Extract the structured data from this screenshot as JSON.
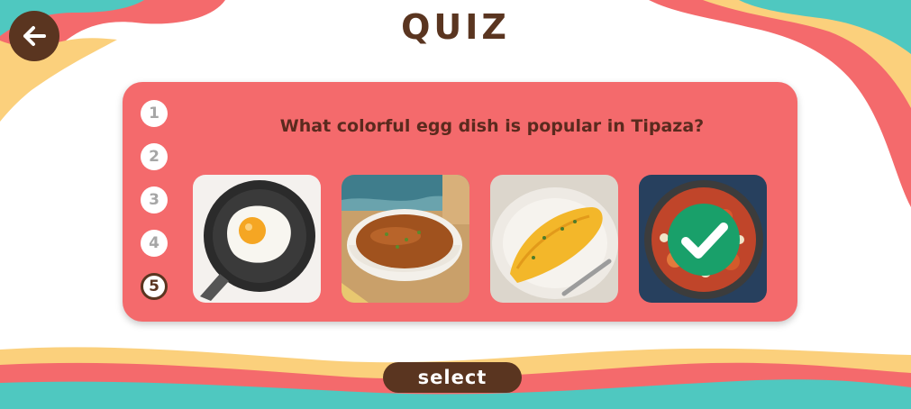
{
  "header": {
    "title": "QUIZ",
    "back_icon": "arrow-left-icon"
  },
  "quiz": {
    "question": "What colorful egg dish is popular in Tipaza?",
    "steps": [
      "1",
      "2",
      "3",
      "4",
      "5"
    ],
    "current_step": 5,
    "options": [
      {
        "name": "fried-egg-pan"
      },
      {
        "name": "soup-bowl"
      },
      {
        "name": "omelette-plate"
      },
      {
        "name": "shakshuka-pan",
        "selected": true
      }
    ]
  },
  "footer": {
    "select_label": "select"
  },
  "colors": {
    "card": "#f46a6c",
    "brown": "#5a3520",
    "teal": "#4fc8c0",
    "yellow": "#fbd07c",
    "check": "#1aa06b"
  }
}
